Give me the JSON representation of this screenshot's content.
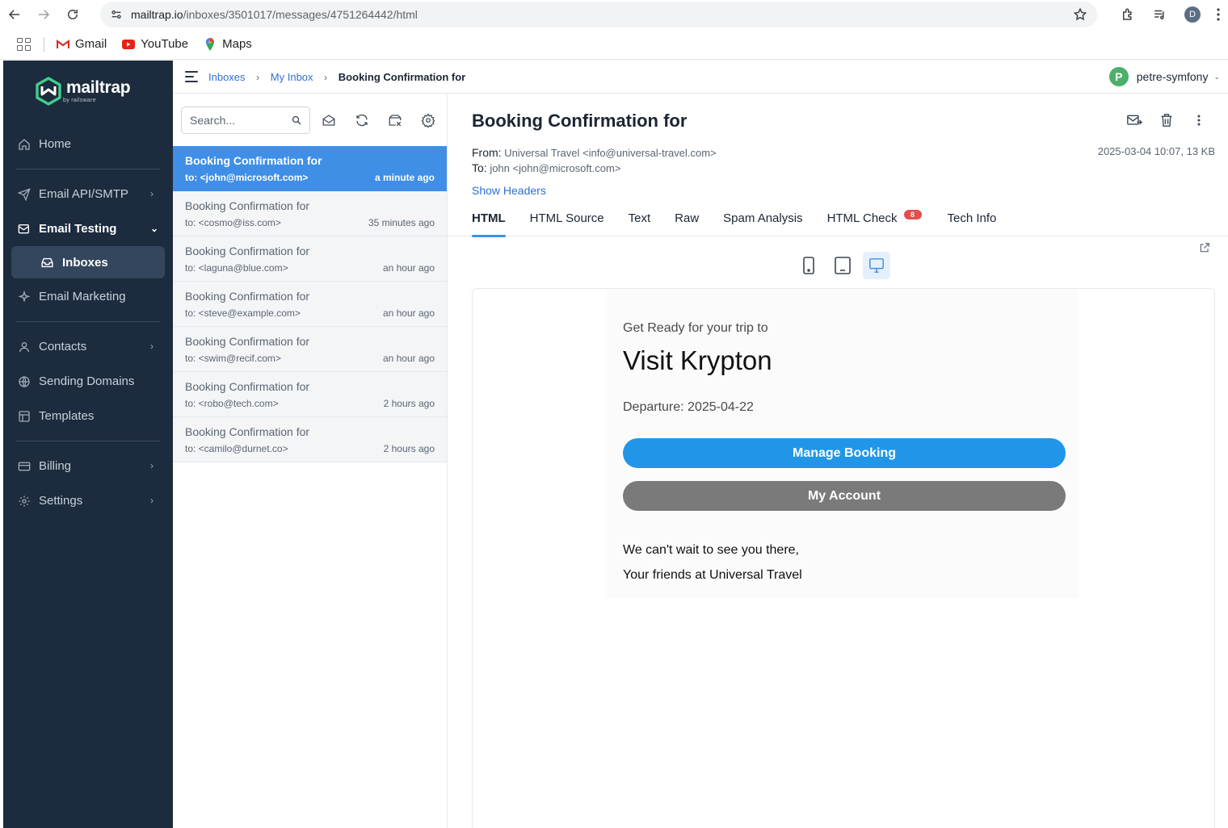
{
  "browser": {
    "url_host": "mailtrap.io",
    "url_path": "/inboxes/3501017/messages/4751264442/html",
    "profile_initial": "D",
    "bookmarks": [
      "Gmail",
      "YouTube",
      "Maps"
    ]
  },
  "brand": {
    "name": "mailtrap",
    "sub": "by railsware"
  },
  "sidebar": {
    "items": [
      {
        "label": "Home"
      },
      {
        "label": "Email API/SMTP"
      },
      {
        "label": "Email Testing"
      },
      {
        "label": "Inboxes"
      },
      {
        "label": "Email Marketing"
      },
      {
        "label": "Contacts"
      },
      {
        "label": "Sending Domains"
      },
      {
        "label": "Templates"
      },
      {
        "label": "Billing"
      },
      {
        "label": "Settings"
      }
    ]
  },
  "breadcrumb": {
    "inboxes": "Inboxes",
    "my_inbox": "My Inbox",
    "current": "Booking Confirmation for",
    "sep": "›"
  },
  "user": {
    "initial": "P",
    "name": "petre-symfony",
    "caret": "⌄"
  },
  "search": {
    "placeholder": "Search..."
  },
  "messages": [
    {
      "subject": "Booking Confirmation for",
      "to": "to: <john@microsoft.com>",
      "time": "a minute ago"
    },
    {
      "subject": "Booking Confirmation for",
      "to": "to: <cosmo@iss.com>",
      "time": "35 minutes ago"
    },
    {
      "subject": "Booking Confirmation for",
      "to": "to: <laguna@blue.com>",
      "time": "an hour ago"
    },
    {
      "subject": "Booking Confirmation for",
      "to": "to: <steve@example.com>",
      "time": "an hour ago"
    },
    {
      "subject": "Booking Confirmation for",
      "to": "to: <swim@recif.com>",
      "time": "an hour ago"
    },
    {
      "subject": "Booking Confirmation for",
      "to": "to: <robo@tech.com>",
      "time": "2 hours ago"
    },
    {
      "subject": "Booking Confirmation for",
      "to": "to: <camilo@durnet.co>",
      "time": "2 hours ago"
    }
  ],
  "view": {
    "title": "Booking Confirmation for",
    "from_label": "From:",
    "from_value": "Universal Travel <info@universal-travel.com>",
    "to_label": "To:",
    "to_value": "john <john@microsoft.com>",
    "date_size": "2025-03-04 10:07, 13 KB",
    "show_headers": "Show Headers",
    "tabs": [
      {
        "label": "HTML"
      },
      {
        "label": "HTML Source"
      },
      {
        "label": "Text"
      },
      {
        "label": "Raw"
      },
      {
        "label": "Spam Analysis"
      },
      {
        "label": "HTML Check",
        "badge": "8"
      },
      {
        "label": "Tech Info"
      }
    ]
  },
  "email": {
    "pre": "Get Ready for your trip to",
    "title": "Visit Krypton",
    "departure": "Departure: 2025-04-22",
    "primary_button": "Manage Booking",
    "secondary_button": "My Account",
    "sign1": "We can't wait to see you there,",
    "sign2": "Your friends at Universal Travel"
  },
  "colors": {
    "sidebar": "#1c2b3d",
    "accent": "#3f8fe6",
    "email_primary": "#2196e8",
    "email_secondary": "#7a7a7a",
    "badge": "#e84c4c",
    "avatar": "#4caf6a"
  }
}
